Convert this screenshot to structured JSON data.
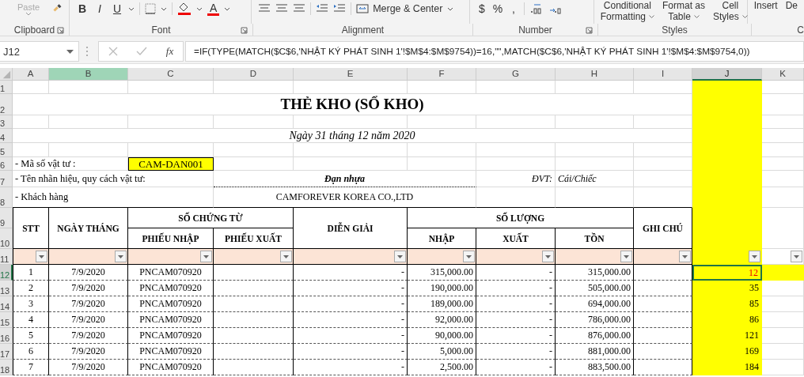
{
  "ribbon": {
    "paste": "Paste",
    "font_buttons": [
      "B",
      "I",
      "U"
    ],
    "font_color": "A",
    "merge": "Merge & Center",
    "number_buttons": [
      "$",
      "%",
      ","
    ],
    "style_buttons": [
      {
        "top": "Conditional",
        "bottom": "Formatting"
      },
      {
        "top": "Format as",
        "bottom": "Table"
      },
      {
        "top": "Cell",
        "bottom": "Styles"
      }
    ],
    "cell_buttons": [
      "Insert",
      "De"
    ],
    "groups": [
      {
        "label": "Clipboard",
        "launcher": true
      },
      {
        "label": "Font",
        "launcher": true
      },
      {
        "label": "Alignment",
        "launcher": false
      },
      {
        "label": "Number",
        "launcher": true
      },
      {
        "label": "Styles",
        "launcher": false
      },
      {
        "label": "C",
        "launcher": false
      }
    ]
  },
  "formula_bar": {
    "name_box": "J12",
    "fx": "fx",
    "formula": "=IF(TYPE(MATCH($C$6,'NHẬT KÝ PHÁT SINH 1'!$M$4:$M$9754))=16,\"\",MATCH($C$6,'NHẬT KÝ PHÁT SINH 1'!$M$4:$M$9754,0))"
  },
  "columns": [
    {
      "label": "A",
      "selected": false,
      "highlighted": false
    },
    {
      "label": "B",
      "selected": false,
      "highlighted": true
    },
    {
      "label": "C",
      "selected": false,
      "highlighted": false
    },
    {
      "label": "D",
      "selected": false,
      "highlighted": false
    },
    {
      "label": "E",
      "selected": false,
      "highlighted": false
    },
    {
      "label": "F",
      "selected": false,
      "highlighted": false
    },
    {
      "label": "G",
      "selected": false,
      "highlighted": false
    },
    {
      "label": "H",
      "selected": false,
      "highlighted": false
    },
    {
      "label": "I",
      "selected": false,
      "highlighted": false
    },
    {
      "label": "J",
      "selected": true,
      "highlighted": false
    },
    {
      "label": "K",
      "selected": false,
      "highlighted": false
    }
  ],
  "row_numbers": [
    {
      "label": "1",
      "selected": false
    },
    {
      "label": "2",
      "selected": false
    },
    {
      "label": "3",
      "selected": false
    },
    {
      "label": "4",
      "selected": false
    },
    {
      "label": "5",
      "selected": false
    },
    {
      "label": "6",
      "selected": false
    },
    {
      "label": "7",
      "selected": false
    },
    {
      "label": "8",
      "selected": false
    },
    {
      "label": "9",
      "selected": false
    },
    {
      "label": "10",
      "selected": false
    },
    {
      "label": "11",
      "selected": false
    },
    {
      "label": "12",
      "selected": true
    },
    {
      "label": "13",
      "selected": false
    },
    {
      "label": "14",
      "selected": false
    },
    {
      "label": "15",
      "selected": false
    },
    {
      "label": "16",
      "selected": false
    },
    {
      "label": "17",
      "selected": false
    },
    {
      "label": "18",
      "selected": false
    }
  ],
  "sheet": {
    "title": "THẺ KHO (SỔ KHO)",
    "date": "Ngày 31 tháng 12 năm 2020",
    "item_code_label": "- Mã số vật tư :",
    "item_code": "CAM-DAN001",
    "spec_label": "- Tên nhãn hiệu, quy cách vật tư:",
    "spec": "Đạn nhựa",
    "unit_label": "ĐVT:",
    "unit": "Cái/Chiếc",
    "customer_label": "- Khách hàng",
    "customer": "CAMFOREVER KOREA CO.,LTD",
    "headers": {
      "stt": "STT",
      "date": "NGÀY THÁNG",
      "voucher": "SỐ CHỨNG TỪ",
      "receipt": "PHIẾU NHẬP",
      "issue": "PHIẾU XUẤT",
      "description": "DIỄN GIẢI",
      "quantity": "SỐ LƯỢNG",
      "in": "NHẬP",
      "out": "XUẤT",
      "balance": "TỒN",
      "note": "GHI CHÚ"
    },
    "rows": [
      {
        "stt": "1",
        "date": "7/9/2020",
        "receipt": "PNCAM070920",
        "description": "-",
        "in": "315,000.00",
        "out": "-",
        "balance": "315,000.00",
        "j": "12",
        "selected": true,
        "flagged": true
      },
      {
        "stt": "2",
        "date": "7/9/2020",
        "receipt": "PNCAM070920",
        "description": "-",
        "in": "190,000.00",
        "out": "-",
        "balance": "505,000.00",
        "j": "35",
        "selected": false,
        "flagged": false
      },
      {
        "stt": "3",
        "date": "7/9/2020",
        "receipt": "PNCAM070920",
        "description": "-",
        "in": "189,000.00",
        "out": "-",
        "balance": "694,000.00",
        "j": "85",
        "selected": false,
        "flagged": false
      },
      {
        "stt": "4",
        "date": "7/9/2020",
        "receipt": "PNCAM070920",
        "description": "-",
        "in": "92,000.00",
        "out": "-",
        "balance": "786,000.00",
        "j": "86",
        "selected": false,
        "flagged": false
      },
      {
        "stt": "5",
        "date": "7/9/2020",
        "receipt": "PNCAM070920",
        "description": "-",
        "in": "90,000.00",
        "out": "-",
        "balance": "876,000.00",
        "j": "121",
        "selected": false,
        "flagged": false
      },
      {
        "stt": "6",
        "date": "7/9/2020",
        "receipt": "PNCAM070920",
        "description": "-",
        "in": "5,000.00",
        "out": "-",
        "balance": "881,000.00",
        "j": "169",
        "selected": false,
        "flagged": false
      },
      {
        "stt": "7",
        "date": "7/9/2020",
        "receipt": "PNCAM070920",
        "description": "-",
        "in": "2,500.00",
        "out": "-",
        "balance": "883,500.00",
        "j": "184",
        "selected": false,
        "flagged": false
      }
    ]
  }
}
